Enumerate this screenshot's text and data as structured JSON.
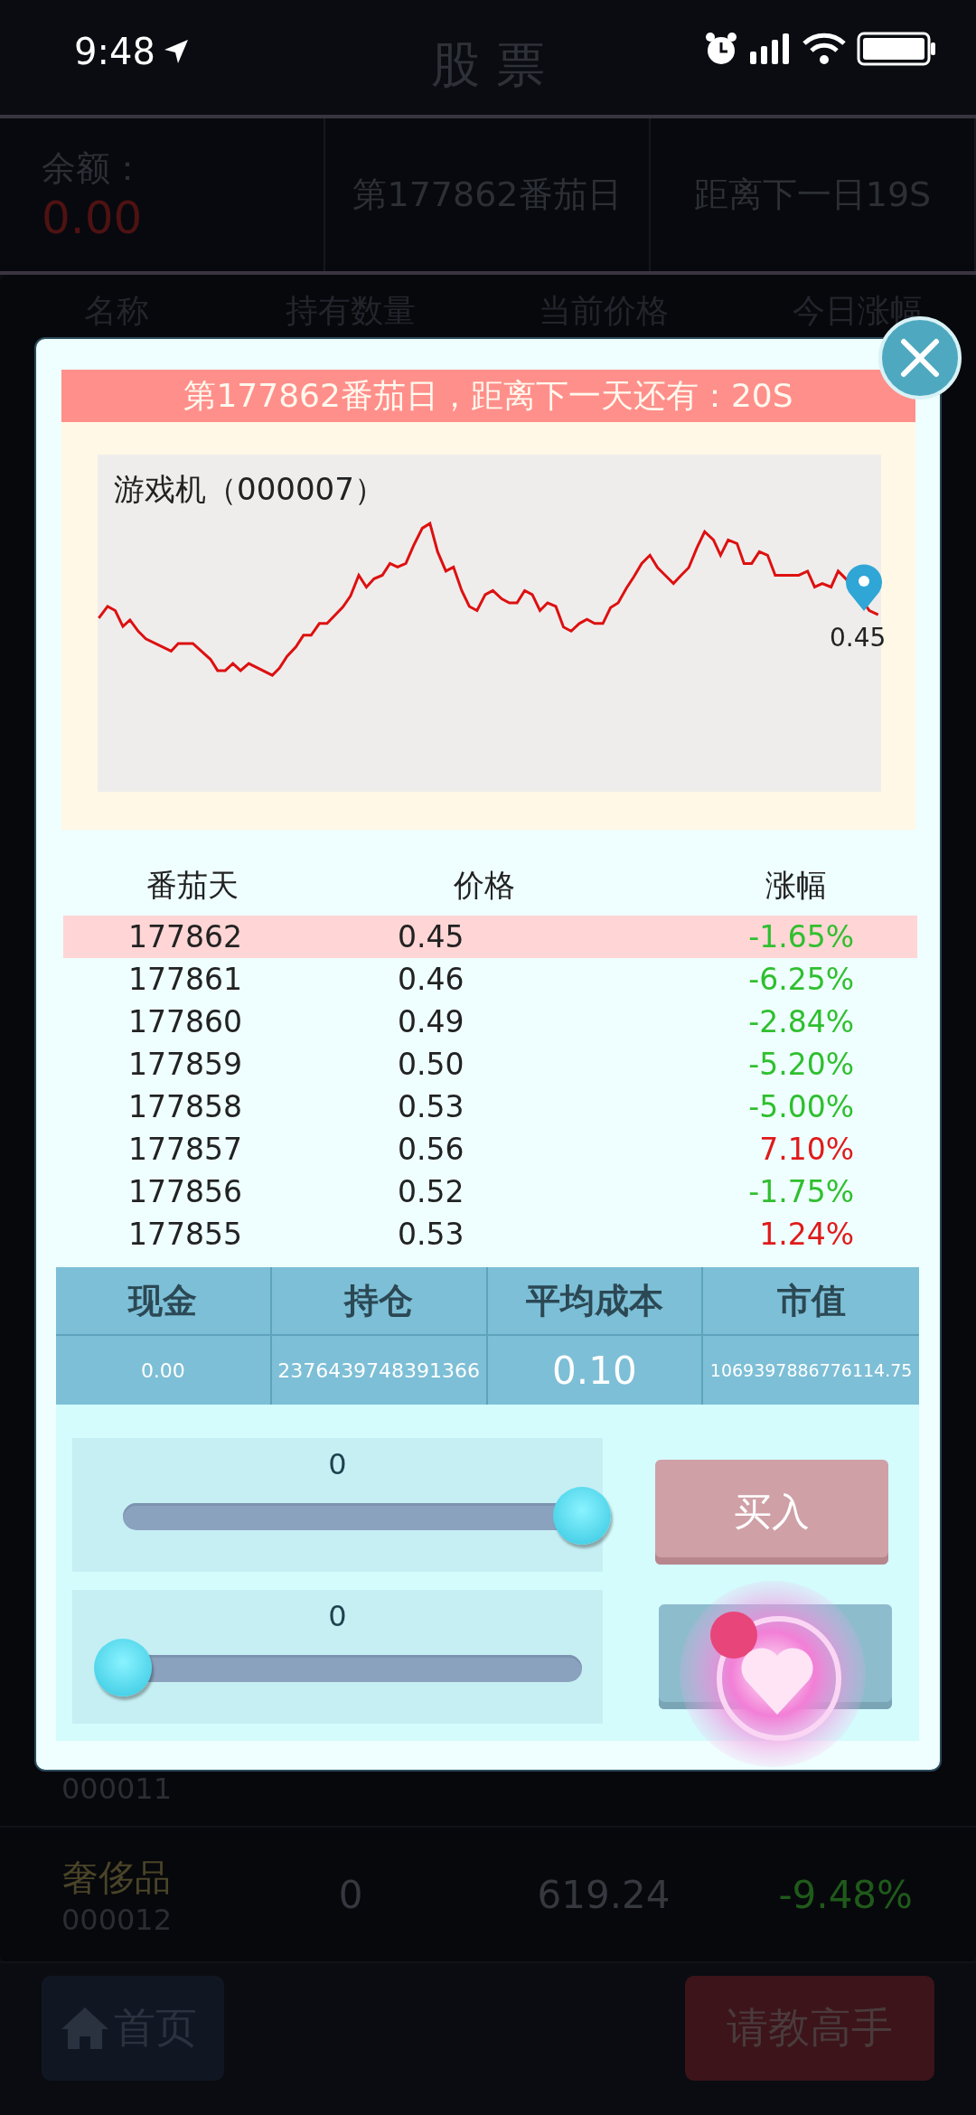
{
  "status_bar": {
    "time": "9:48"
  },
  "title": "股 票",
  "info_bar": {
    "balance_label": "余额：",
    "balance": "0.00",
    "day": "第177862番茄日",
    "countdown": "距离下一日19S"
  },
  "stock_list": {
    "columns": [
      "名称",
      "持有数量",
      "当前价格",
      "今日涨幅"
    ],
    "rows": [
      {
        "code": "000011"
      },
      {
        "name": "奢侈品",
        "code": "000012",
        "quantity": "0",
        "price": "619.24",
        "change": "-9.48%",
        "color": "#1f5a1a"
      }
    ]
  },
  "nav_buttons": [
    {
      "label": "首页",
      "kind": "home"
    },
    {
      "label": "请教高手",
      "kind": "primary"
    }
  ],
  "dialog": {
    "banner": "第177862番茄日，距离下一天还有：20S",
    "chart": {
      "title": "游戏机（000007）",
      "last_value": "0.45"
    },
    "history": {
      "columns": [
        "番茄天",
        "价格",
        "涨幅"
      ],
      "rows": [
        {
          "day": "177862",
          "price": "0.45",
          "change": "-1.65%",
          "color": "#2fbf2f",
          "selected": true
        },
        {
          "day": "177861",
          "price": "0.46",
          "change": "-6.25%",
          "color": "#2fbf2f",
          "selected": false
        },
        {
          "day": "177860",
          "price": "0.49",
          "change": "-2.84%",
          "color": "#2fbf2f",
          "selected": false
        },
        {
          "day": "177859",
          "price": "0.50",
          "change": "-5.20%",
          "color": "#2fbf2f",
          "selected": false
        },
        {
          "day": "177858",
          "price": "0.53",
          "change": "-5.00%",
          "color": "#2fbf2f",
          "selected": false
        },
        {
          "day": "177857",
          "price": "0.56",
          "change": "7.10%",
          "color": "#e01a1a",
          "selected": false
        },
        {
          "day": "177856",
          "price": "0.52",
          "change": "-1.75%",
          "color": "#2fbf2f",
          "selected": false
        },
        {
          "day": "177855",
          "price": "0.53",
          "change": "1.24%",
          "color": "#e01a1a",
          "selected": false
        }
      ]
    },
    "holdings": {
      "columns": [
        "现金",
        "持仓",
        "平均成本",
        "市值"
      ],
      "values": [
        "0.00",
        "2376439748391366",
        "0.10",
        "1069397886776114.75"
      ]
    },
    "sliders": [
      {
        "value": "0",
        "level": 1
      },
      {
        "value": "0",
        "level": 0
      }
    ],
    "buttons": [
      {
        "label": "买入",
        "kind": "buy"
      },
      {
        "kind": "sell"
      }
    ]
  }
}
